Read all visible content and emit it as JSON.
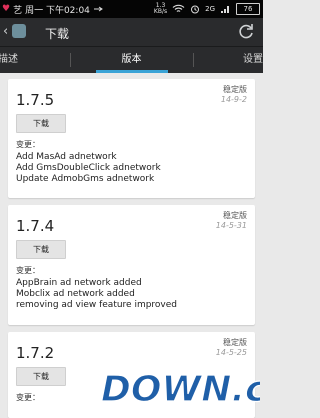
{
  "status_bar": {
    "carrier": "艺",
    "time": "周一 下午02:04",
    "speed_value": "1.3",
    "speed_unit": "KB/s",
    "signal": "2G",
    "battery": "76"
  },
  "app_bar": {
    "title": "下载"
  },
  "tabs": [
    {
      "label": "描述",
      "selected": false
    },
    {
      "label": "版本",
      "selected": true
    },
    {
      "label": "设置",
      "selected": false
    }
  ],
  "versions": [
    {
      "version": "1.7.5",
      "badge": "稳定版",
      "date": "14-9-2",
      "download_label": "下载",
      "changes_title": "变更：",
      "changes": [
        "Add MasAd adnetwork",
        "Add GmsDoubleClick adnetwork",
        "Update AdmobGms adnetwork"
      ]
    },
    {
      "version": "1.7.4",
      "badge": "稳定版",
      "date": "14-5-31",
      "download_label": "下载",
      "changes_title": "变更：",
      "changes": [
        "AppBrain ad network added",
        "Mobclix ad network added",
        "removing ad view feature improved"
      ]
    },
    {
      "version": "1.7.2",
      "badge": "稳定版",
      "date": "14-5-25",
      "download_label": "下载",
      "changes_title": "变更：",
      "changes": []
    }
  ],
  "watermark": {
    "text": "DOWN.cc"
  },
  "colors": {
    "accent": "#3aa3d6",
    "appbar": "#2a2b2d",
    "background": "#e9e9e9"
  }
}
